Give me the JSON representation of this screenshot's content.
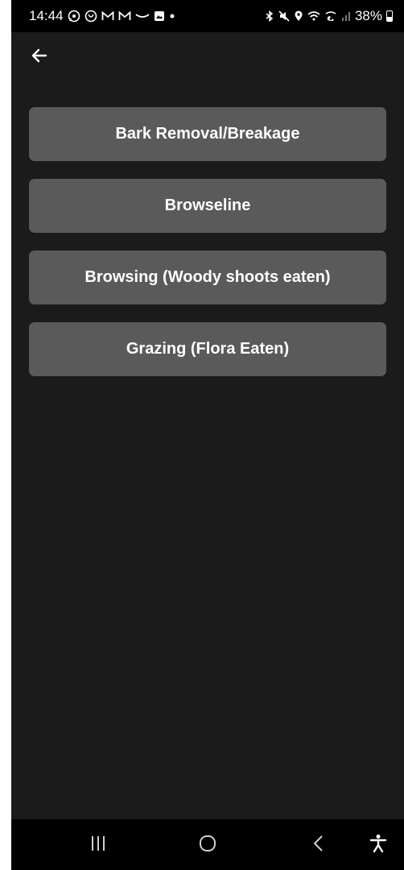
{
  "status_bar": {
    "time": "14:44",
    "battery": "38%",
    "left_icons": [
      "whatsapp-icon",
      "virgin-icon",
      "gmail-icon",
      "gmail-icon",
      "amazon-icon",
      "gallery-icon",
      "dot-icon"
    ],
    "right_icons": [
      "bluetooth-icon",
      "mute-icon",
      "location-icon",
      "wifi-icon",
      "wifi-calling-icon",
      "signal-icon",
      "battery-icon"
    ]
  },
  "app_bar": {
    "back_icon": "arrow-left-icon"
  },
  "options": [
    {
      "label": "Bark Removal/Breakage"
    },
    {
      "label": "Browseline"
    },
    {
      "label": "Browsing (Woody shoots eaten)"
    },
    {
      "label": "Grazing (Flora Eaten)"
    }
  ],
  "nav_bar": {
    "buttons": [
      "recent-apps-icon",
      "home-icon",
      "back-icon",
      "accessibility-icon"
    ]
  },
  "colors": {
    "background": "#1b1b1b",
    "button": "#5a5a5a",
    "bar": "#000000",
    "text": "#ffffff"
  }
}
